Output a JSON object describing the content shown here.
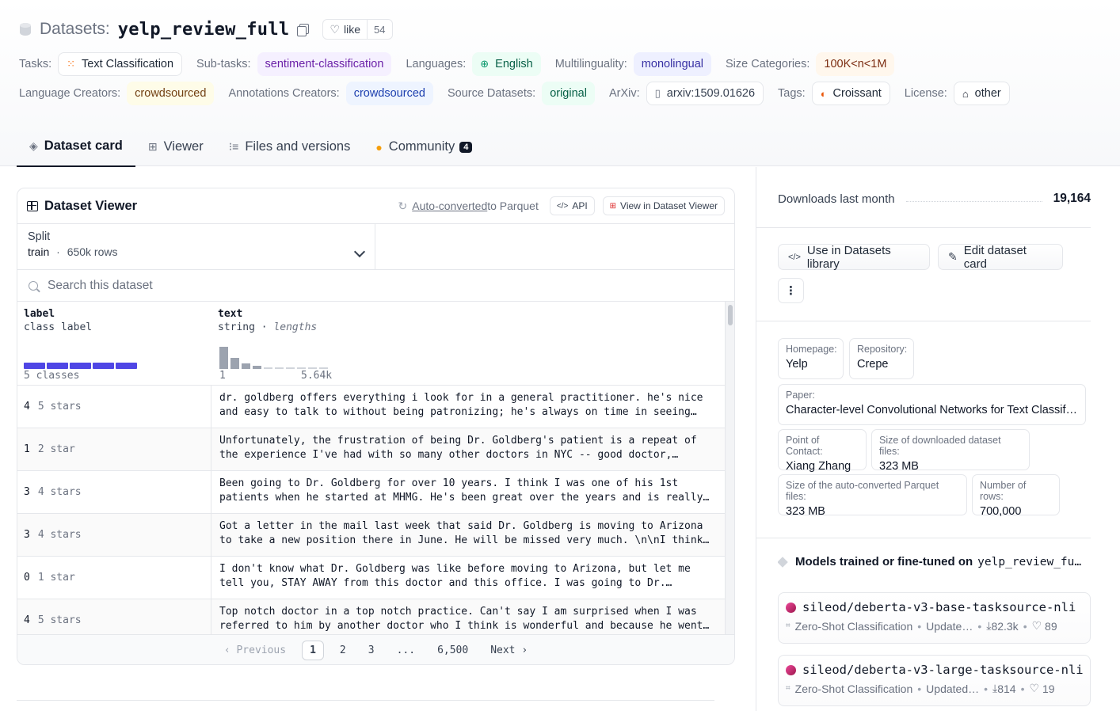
{
  "header": {
    "title_label": "Datasets:",
    "title_name": "yelp_review_full",
    "like_label": "like",
    "like_count": "54"
  },
  "meta_row1": {
    "tasks_label": "Tasks:",
    "task_value": "Text Classification",
    "subtasks_label": "Sub-tasks:",
    "subtask_value": "sentiment-classification",
    "languages_label": "Languages:",
    "language_value": "English",
    "multilinguality_label": "Multilinguality:",
    "multilinguality_value": "monolingual",
    "size_label": "Size Categories:",
    "size_value": "100K<n<1M"
  },
  "meta_row2": {
    "lang_creators_label": "Language Creators:",
    "lang_creators_value": "crowdsourced",
    "ann_creators_label": "Annotations Creators:",
    "ann_creators_value": "crowdsourced",
    "source_label": "Source Datasets:",
    "source_value": "original",
    "arxiv_label": "ArXiv:",
    "arxiv_value": "arxiv:1509.01626",
    "tags_label": "Tags:",
    "tags_value": "Croissant",
    "license_label": "License:",
    "license_value": "other"
  },
  "tabs": [
    {
      "label": "Dataset card"
    },
    {
      "label": "Viewer"
    },
    {
      "label": "Files and versions"
    },
    {
      "label": "Community",
      "badge": "4"
    }
  ],
  "viewer": {
    "title": "Dataset Viewer",
    "parquet_link": "Auto-converted",
    "parquet_rest": " to Parquet",
    "api_label": "API",
    "view_label": "View in Dataset Viewer",
    "split_label": "Split",
    "split_name": "train",
    "split_dot": "·",
    "split_rows": "650k rows",
    "search_placeholder": "Search this dataset",
    "columns": {
      "label": {
        "name": "label",
        "type": "class label",
        "summary": "5 classes"
      },
      "text": {
        "name": "text",
        "type": "string",
        "type_sep": " · ",
        "type_extra": "lengths",
        "min": "1",
        "max": "5.64k"
      }
    },
    "rows": [
      {
        "label": "4",
        "cls": "5 stars",
        "line1": "dr. goldberg offers everything i look for in a general practitioner. he's nice",
        "line2": "and easy to talk to without being patronizing; he's always on time in seeing…"
      },
      {
        "label": "1",
        "cls": "2 star",
        "line1": "Unfortunately, the frustration of being Dr. Goldberg's patient is a repeat of",
        "line2": "the experience I've had with so many other doctors in NYC -- good doctor,…"
      },
      {
        "label": "3",
        "cls": "4 stars",
        "line1": "Been going to Dr. Goldberg for over 10 years. I think I was one of his 1st",
        "line2": "patients when he started at MHMG. He's been great over the years and is really…"
      },
      {
        "label": "3",
        "cls": "4 stars",
        "line1": "Got a letter in the mail last week that said Dr. Goldberg is moving to Arizona",
        "line2": "to take a new position there in June. He will be missed very much. \\n\\nI think…"
      },
      {
        "label": "0",
        "cls": "1 star",
        "line1": "I don't know what Dr. Goldberg was like before moving to Arizona, but let me",
        "line2": "tell you, STAY AWAY from this doctor and this office. I was going to Dr.…"
      },
      {
        "label": "4",
        "cls": "5 stars",
        "line1": "Top notch doctor in a top notch practice. Can't say I am surprised when I was",
        "line2": "referred to him by another doctor who I think is wonderful and because he went…"
      }
    ],
    "pager": {
      "prev": "Previous",
      "pages": [
        "1",
        "2",
        "3",
        "...",
        "6,500"
      ],
      "next": "Next"
    }
  },
  "sidebar": {
    "downloads_label": "Downloads last month",
    "downloads_value": "19,164",
    "use_library": "Use in Datasets library",
    "edit_card": "Edit dataset card",
    "more": "⋮",
    "info": {
      "homepage_k": "Homepage:",
      "homepage_v": "Yelp",
      "repository_k": "Repository:",
      "repository_v": "Crepe",
      "paper_k": "Paper:",
      "paper_v": "Character-level Convolutional Networks for Text Classification",
      "contact_k": "Point of Contact:",
      "contact_v": "Xiang Zhang",
      "download_size_k": "Size of downloaded dataset files:",
      "download_size_v": "323 MB",
      "parquet_size_k": "Size of the auto-converted Parquet files:",
      "parquet_size_v": "323 MB",
      "num_rows_k": "Number of rows:",
      "num_rows_v": "700,000"
    },
    "models_title": "Models trained or fine-tuned on",
    "models_title_ds": "yelp_review_fu…",
    "models": [
      {
        "name": "sileod/deberta-v3-base-tasksource-nli",
        "task": "Zero-Shot Classification",
        "updated": "Update…",
        "downloads": "82.3k",
        "likes": "89"
      },
      {
        "name": "sileod/deberta-v3-large-tasksource-nli",
        "task": "Zero-Shot Classification",
        "updated": "Updated…",
        "downloads": "814",
        "likes": "19"
      }
    ]
  }
}
